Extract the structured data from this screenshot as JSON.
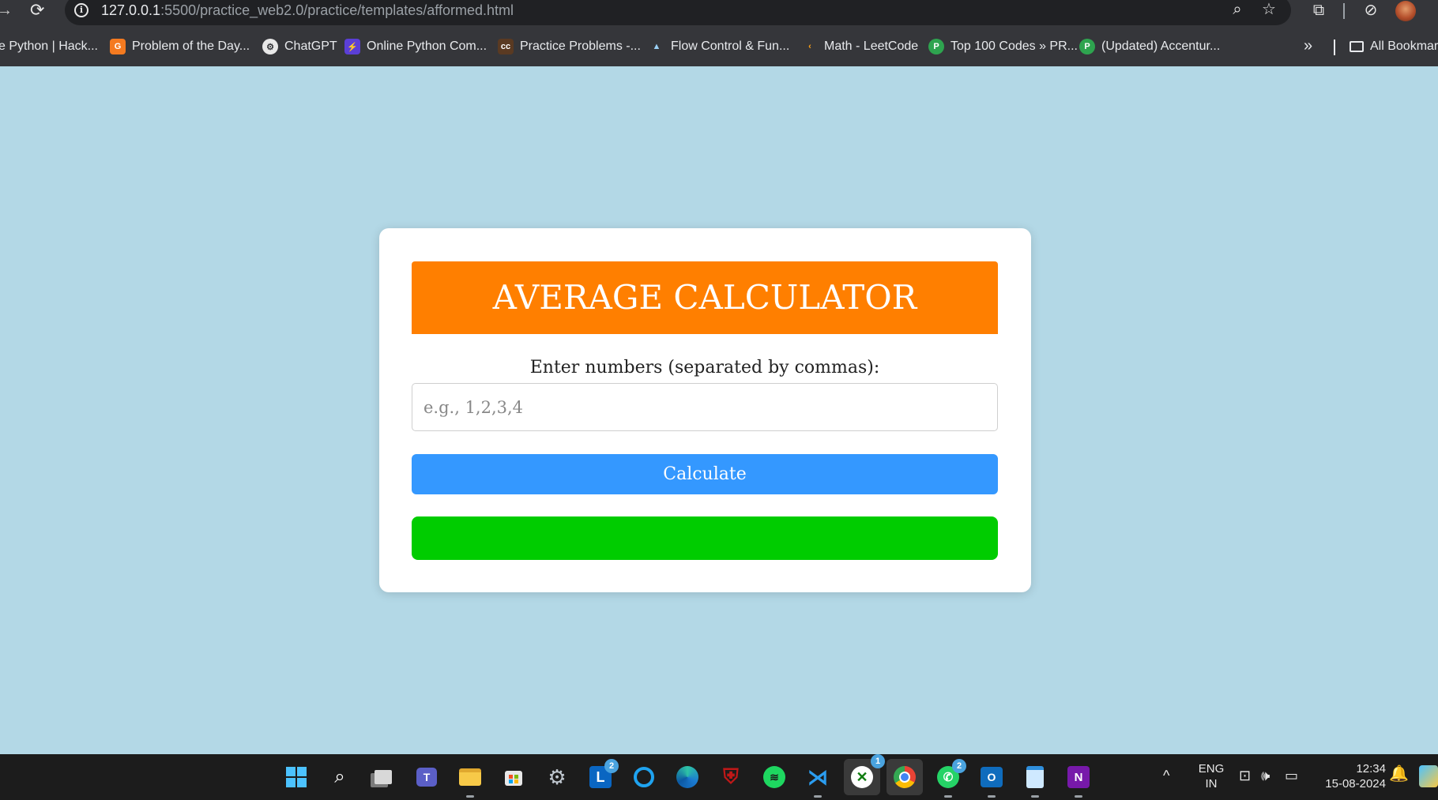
{
  "browser": {
    "url_host": "127.0.0.1",
    "url_path": ":5500/practice_web2.0/practice/templates/afformed.html",
    "bookmarks": [
      {
        "label": "e Python | Hack...",
        "icon": "hackerrank-icon",
        "color": ""
      },
      {
        "label": "Problem of the Day...",
        "icon": "gfg-icon",
        "color": "#f47a20"
      },
      {
        "label": "ChatGPT",
        "icon": "chatgpt-icon",
        "color": "#e8e8e8"
      },
      {
        "label": "Online Python Com...",
        "icon": "bolt-icon",
        "color": "#5b3fd6"
      },
      {
        "label": "Practice Problems -...",
        "icon": "codechef-icon",
        "color": "#5a3a22"
      },
      {
        "label": "Flow Control & Fun...",
        "icon": "mountain-icon",
        "color": "#35363a"
      },
      {
        "label": "Math - LeetCode",
        "icon": "leetcode-icon",
        "color": "#35363a"
      },
      {
        "label": "Top 100 Codes » PR...",
        "icon": "prepinsta-icon",
        "color": "#2ea44f"
      },
      {
        "label": "(Updated) Accentur...",
        "icon": "prepinsta-icon",
        "color": "#2ea44f"
      }
    ],
    "more_label": "»",
    "all_bookmarks": "All Bookmarks"
  },
  "page": {
    "title": "AVERAGE CALCULATOR",
    "input_label": "Enter numbers (separated by commas):",
    "input_placeholder": "e.g., 1,2,3,4",
    "input_value": "",
    "button_label": "Calculate",
    "result": "",
    "colors": {
      "background": "#b3d8e6",
      "title_bg": "#ff7f00",
      "button_bg": "#3498ff",
      "result_bg": "#00cc00"
    }
  },
  "taskbar": {
    "apps": [
      {
        "name": "start-icon",
        "badge": ""
      },
      {
        "name": "search-icon",
        "badge": ""
      },
      {
        "name": "task-view-icon",
        "badge": ""
      },
      {
        "name": "teams-icon",
        "badge": ""
      },
      {
        "name": "file-explorer-icon",
        "badge": ""
      },
      {
        "name": "store-icon",
        "badge": ""
      },
      {
        "name": "settings-icon",
        "badge": ""
      },
      {
        "name": "linkedin-learning-icon",
        "badge": "2"
      },
      {
        "name": "cortana-icon",
        "badge": ""
      },
      {
        "name": "edge-icon",
        "badge": ""
      },
      {
        "name": "mcafee-icon",
        "badge": ""
      },
      {
        "name": "spotify-icon",
        "badge": ""
      },
      {
        "name": "vscode-icon",
        "badge": ""
      },
      {
        "name": "xbox-icon",
        "badge": "1"
      },
      {
        "name": "chrome-icon",
        "badge": ""
      },
      {
        "name": "whatsapp-icon",
        "badge": "2"
      },
      {
        "name": "outlook-icon",
        "badge": ""
      },
      {
        "name": "notepad-icon",
        "badge": ""
      },
      {
        "name": "onenote-icon",
        "badge": ""
      }
    ],
    "language_top": "ENG",
    "language_bottom": "IN",
    "time": "12:34",
    "date": "15-08-2024"
  }
}
